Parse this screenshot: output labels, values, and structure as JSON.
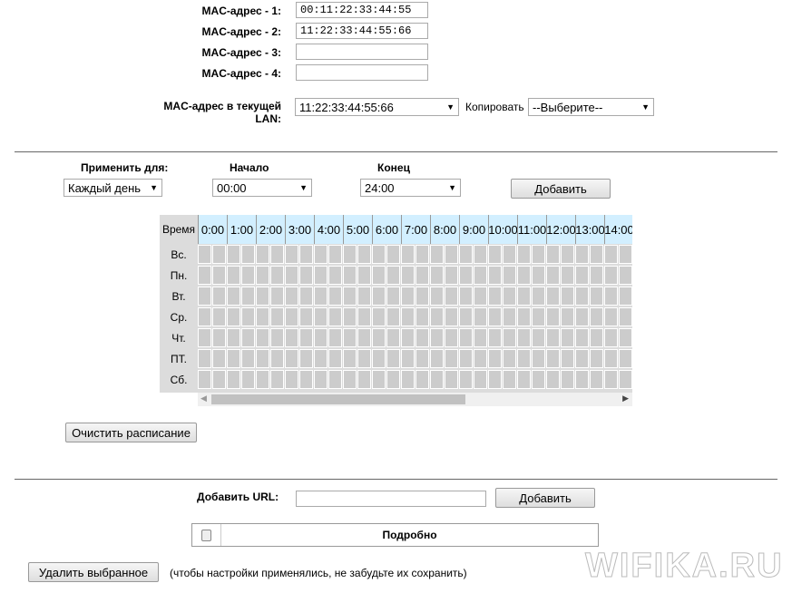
{
  "mac": {
    "labels": [
      "MAC-адрес - 1:",
      "MAC-адрес - 2:",
      "MAC-адрес - 3:",
      "MAC-адрес - 4:"
    ],
    "values": [
      "00:11:22:33:44:55",
      "11:22:33:44:55:66",
      "",
      ""
    ],
    "lan_label": "MAC-адрес в текущей LAN:",
    "lan_value": "11:22:33:44:55:66",
    "copy_label": "Копировать",
    "copy_value": "--Выберите--"
  },
  "schedule": {
    "apply_label": "Применить для:",
    "apply_value": "Каждый день",
    "start_label": "Начало",
    "start_value": "00:00",
    "end_label": "Конец",
    "end_value": "24:00",
    "add_button": "Добавить",
    "time_header": "Время",
    "hours": [
      "0:00",
      "1:00",
      "2:00",
      "3:00",
      "4:00",
      "5:00",
      "6:00",
      "7:00",
      "8:00",
      "9:00",
      "10:00",
      "11:00",
      "12:00",
      "13:00",
      "14:00"
    ],
    "days": [
      "Вс.",
      "Пн.",
      "Вт.",
      "Ср.",
      "Чт.",
      "ПТ.",
      "Сб."
    ],
    "clear_button": "Очистить расписание"
  },
  "url": {
    "label": "Добавить URL:",
    "value": "",
    "add_button": "Добавить",
    "table_header": "Подробно"
  },
  "footer": {
    "delete_button": "Удалить выбранное",
    "note": "(чтобы настройки применялись, не забудьте их сохранить)",
    "watermark": "WIFIKA.RU"
  }
}
